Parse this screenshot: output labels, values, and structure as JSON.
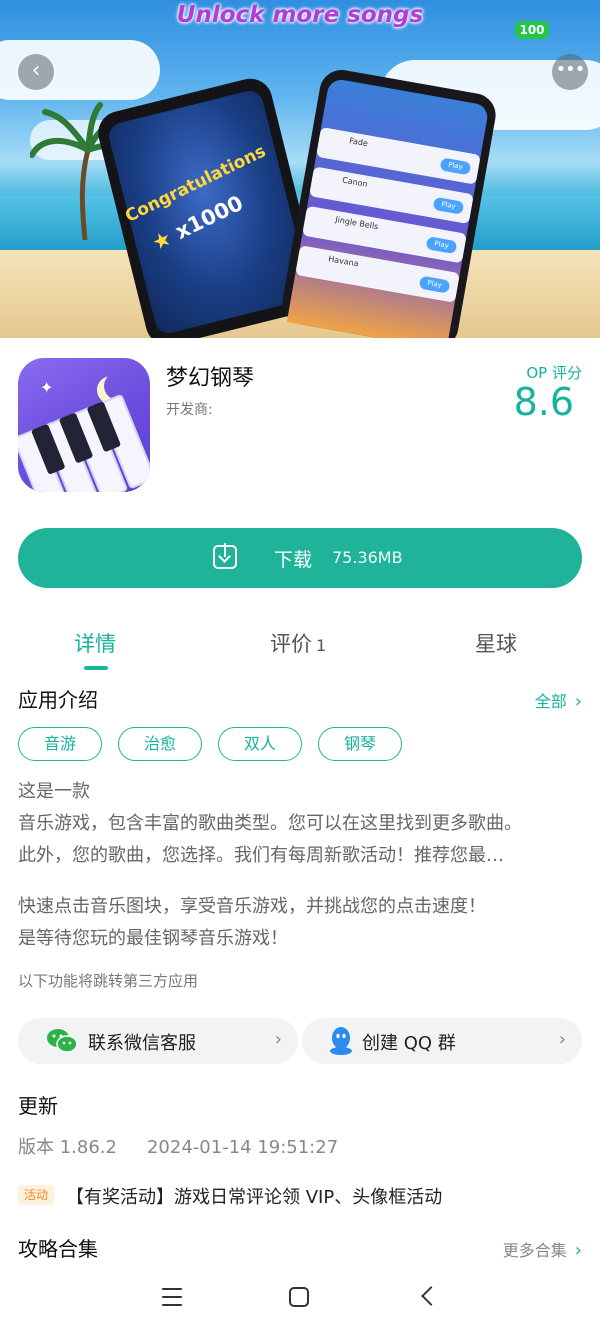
{
  "banner": {
    "title": "Unlock more songs",
    "battery_level": "100",
    "left_phone": {
      "congrats": "Congratulations",
      "multiplier": "x1000"
    },
    "right_phone": {
      "songs": [
        "Fade",
        "Canon",
        "Jingle Bells",
        "Havana"
      ],
      "play_label": "Play"
    }
  },
  "app": {
    "name": "梦幻钢琴",
    "developer_label": "开发商:",
    "score_label": "OP 评分",
    "score": "8.6"
  },
  "download": {
    "label": "下载",
    "size": "75.36MB"
  },
  "tabs": [
    {
      "label": "详情"
    },
    {
      "label": "评价",
      "count": "1"
    },
    {
      "label": "星球"
    }
  ],
  "intro": {
    "title": "应用介绍",
    "all_label": "全部",
    "tags": [
      "音游",
      "治愈",
      "双人",
      "钢琴"
    ],
    "lines": [
      "这是一款",
      "音乐游戏，包含丰富的歌曲类型。您可以在这里找到更多歌曲。",
      "此外，您的歌曲，您选择。我们有每周新歌活动！推荐您最…"
    ],
    "lines2": [
      "快速点击音乐图块，享受音乐游戏，并挑战您的点击速度！",
      "是等待您玩的最佳钢琴音乐游戏！"
    ],
    "third_party_note": "以下功能将跳转第三方应用"
  },
  "contacts": {
    "wechat": "联系微信客服",
    "qq": "创建 QQ 群"
  },
  "update": {
    "title": "更新",
    "version": "版本 1.86.2",
    "date": "2024-01-14 19:51:27",
    "activity_badge": "活动",
    "activity_text": "【有奖活动】游戏日常评论领 VIP、头像框活动"
  },
  "guides": {
    "title": "攻略合集",
    "more_label": "更多合集"
  },
  "colors": {
    "accent": "#1fb39a",
    "banner_title": "#b23bdc"
  }
}
